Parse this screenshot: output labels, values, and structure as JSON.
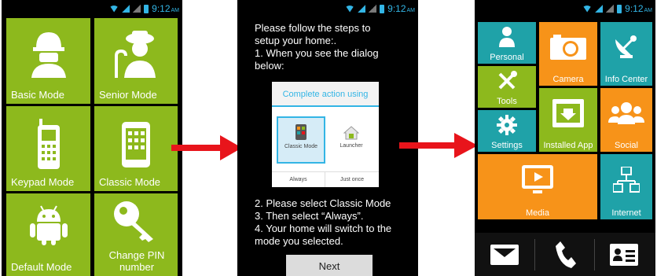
{
  "status_bar": {
    "time": "9:12",
    "ampm": "AM"
  },
  "phone1": {
    "tiles": [
      {
        "label": "Basic Mode",
        "icon": "worker-icon"
      },
      {
        "label": "Senior Mode",
        "icon": "senior-icon"
      },
      {
        "label": "Keypad Mode",
        "icon": "keypad-phone-icon"
      },
      {
        "label": "Classic Mode",
        "icon": "smartphone-icon"
      },
      {
        "label": "Default Mode",
        "icon": "android-icon"
      },
      {
        "label": "Change PIN number",
        "icon": "key-icon"
      }
    ]
  },
  "phone2": {
    "intro_1": "Please follow the steps to",
    "intro_2": "setup your home:.",
    "step1_1": "1. When you see the dialog",
    "step1_2": "below:",
    "dialog": {
      "title": "Complete action using",
      "option1": "Classic Mode",
      "option2": "Launcher",
      "btn_always": "Always",
      "btn_once": "Just once"
    },
    "step2": "2. Please select Classic Mode",
    "step3": "3. Then select “Always”.",
    "step4_1": "4. Your home will switch to the",
    "step4_2": "mode you selected.",
    "next_label": "Next"
  },
  "phone3": {
    "tiles": {
      "personal": "Personal",
      "camera": "Camera",
      "info_center": "Info Center",
      "tools": "Tools",
      "settings": "Settings",
      "installed_app": "Installed App",
      "social": "Social",
      "media": "Media",
      "internet": "Internet"
    },
    "dock": [
      "messages-icon",
      "phone-icon",
      "contacts-icon"
    ]
  },
  "colors": {
    "green": "#8db91d",
    "teal": "#1fa2a8",
    "orange": "#f79319",
    "accent": "#33b5e5",
    "arrow": "#e8141b"
  }
}
